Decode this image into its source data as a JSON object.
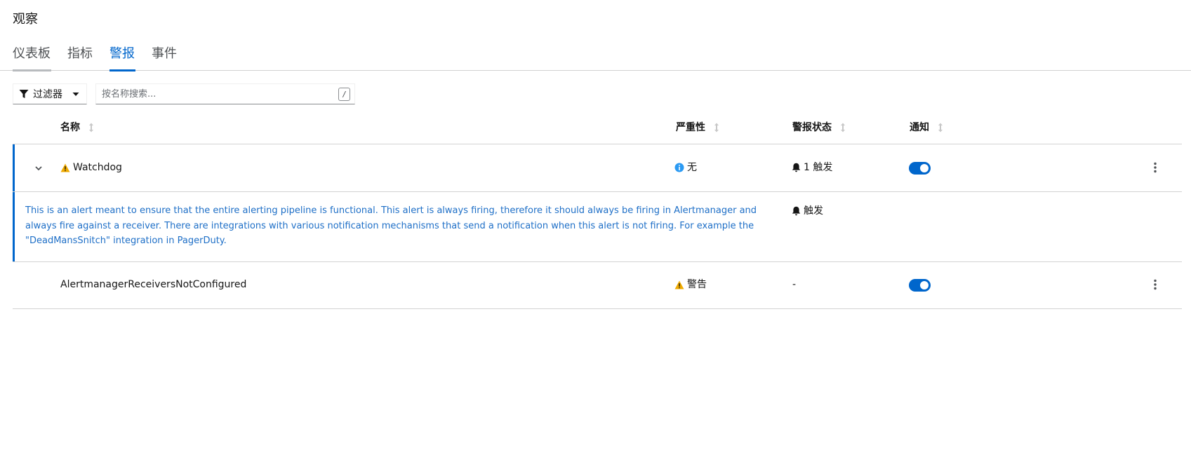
{
  "page": {
    "title": "观察"
  },
  "tabs": [
    {
      "label": "仪表板",
      "state": "default"
    },
    {
      "label": "指标",
      "state": "plain"
    },
    {
      "label": "警报",
      "state": "active"
    },
    {
      "label": "事件",
      "state": "plain"
    }
  ],
  "toolbar": {
    "filter_label": "过滤器",
    "filter_icon": "funnel-icon",
    "search_placeholder": "按名称搜索...",
    "search_value": "",
    "shortcut_hint": "/"
  },
  "table": {
    "columns": [
      "名称",
      "严重性",
      "警报状态",
      "通知"
    ],
    "rows": [
      {
        "name": "Watchdog",
        "name_icon": "warning-triangle-icon",
        "expanded": true,
        "severity": "无",
        "severity_icon": "info-circle-icon",
        "state": "1 触发",
        "state_icon": "bell-icon",
        "notifications": true,
        "details": {
          "description": "This is an alert meant to ensure that the entire alerting pipeline is functional. This alert is always firing, therefore it should always be firing in Alertmanager and always fire against a receiver. There are integrations with various notification mechanisms that send a notification when this alert is not firing. For example the \"DeadMansSnitch\" integration in PagerDuty.",
          "state": "触发",
          "state_icon": "bell-icon"
        }
      },
      {
        "name": "AlertmanagerReceiversNotConfigured",
        "expanded": false,
        "severity": "警告",
        "severity_icon": "warning-triangle-icon",
        "state": "-",
        "notifications": true
      }
    ]
  },
  "colors": {
    "accent": "#0066cc",
    "warning": "#f0ab00",
    "info": "#2b9af3",
    "description_text": "#1e6fc7",
    "border": "#d2d2d2"
  }
}
